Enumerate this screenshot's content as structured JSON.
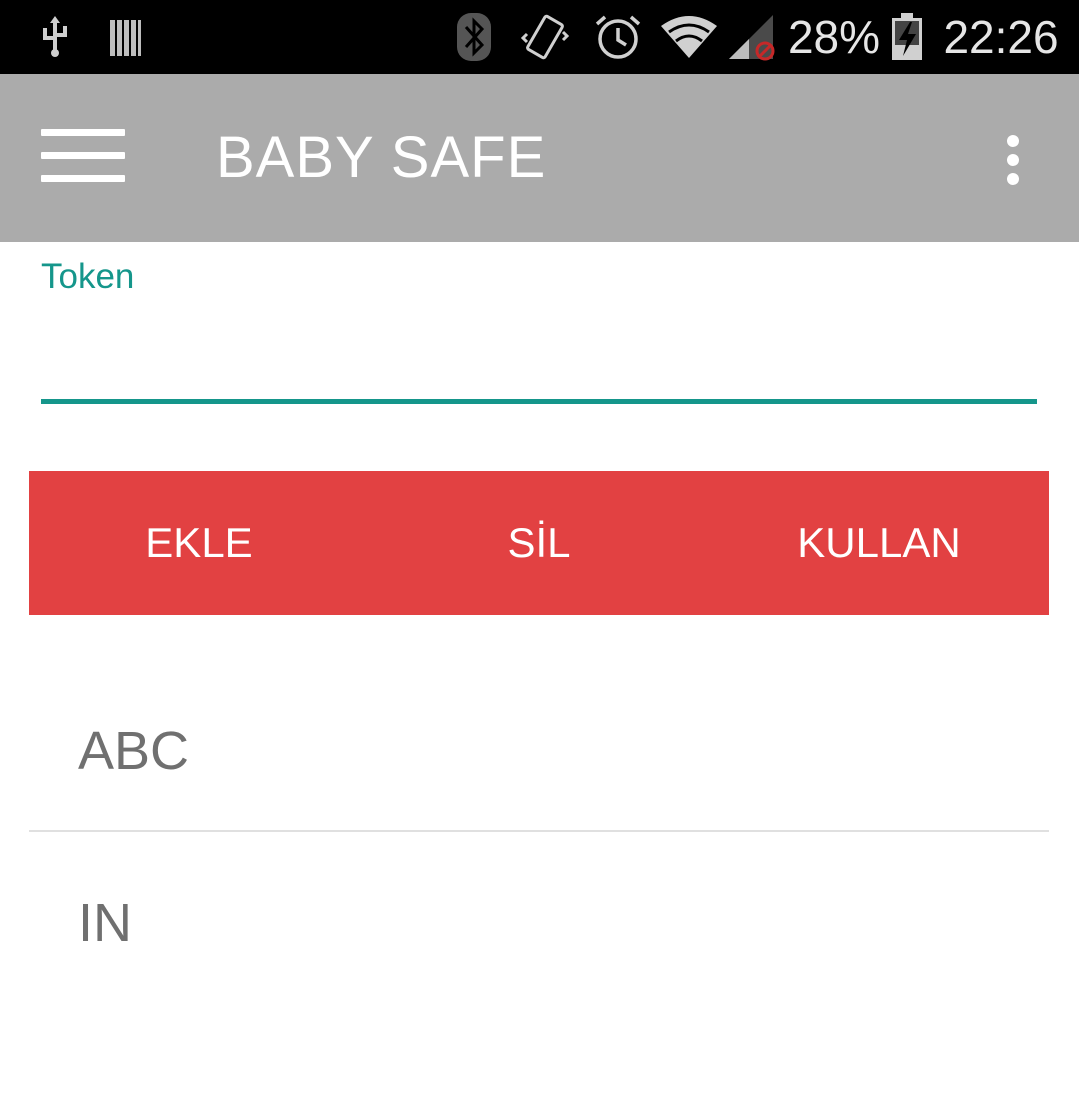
{
  "status_bar": {
    "battery_percent": "28%",
    "time": "22:26",
    "icons": [
      "usb-icon",
      "storage-icon",
      "bluetooth-icon",
      "vibrate-icon",
      "alarm-icon",
      "wifi-icon",
      "signal-icon",
      "battery-charging-icon"
    ]
  },
  "app_bar": {
    "title": "BABY SAFE",
    "menu_icon": "hamburger-menu-icon",
    "overflow_icon": "more-vert-icon"
  },
  "token_field": {
    "label": "Token",
    "value": "",
    "accent_color": "#15968b"
  },
  "actions": {
    "add_label": "EKLE",
    "delete_label": "SİL",
    "use_label": "KULLAN",
    "background_color": "#e24142"
  },
  "tokens": [
    {
      "text": "ABC"
    },
    {
      "text": "IN"
    }
  ]
}
